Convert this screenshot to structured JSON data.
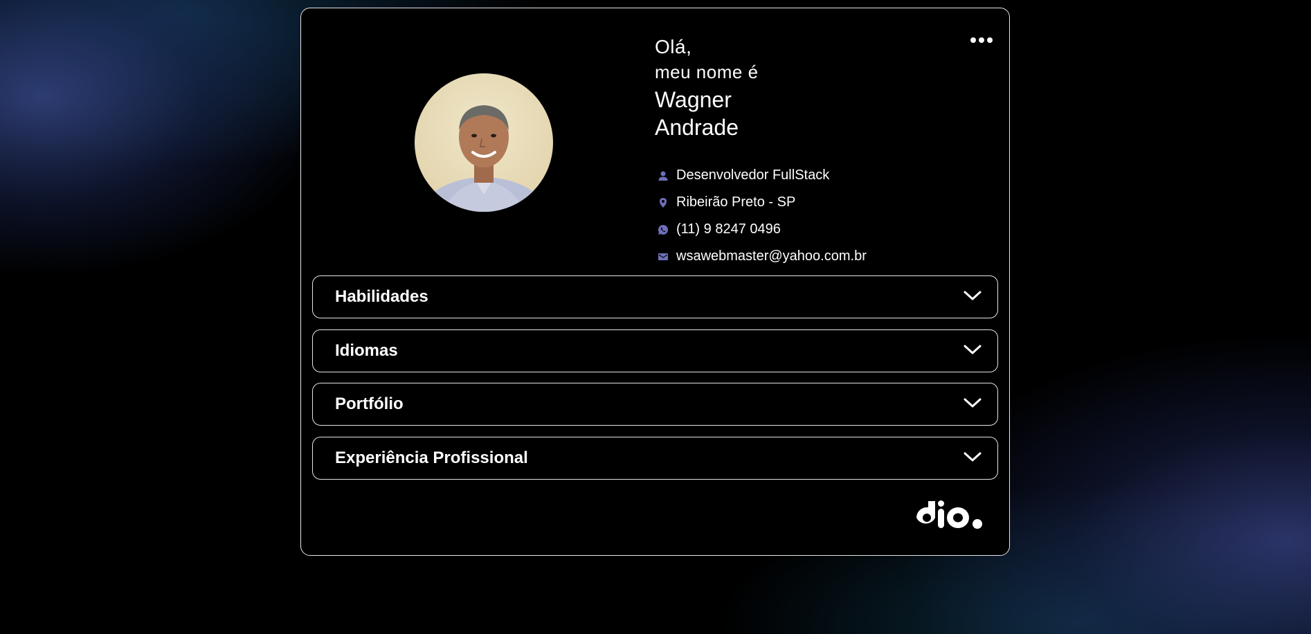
{
  "header": {
    "greeting": "Olá,",
    "subgreeting": "meu nome é",
    "first_name": "Wagner",
    "last_name": "Andrade"
  },
  "info": {
    "role": "Desenvolvedor FullStack",
    "location": "Ribeirão Preto - SP",
    "phone": "(11) 9 8247 0496",
    "email": "wsawebmaster@yahoo.com.br"
  },
  "accordions": [
    {
      "label": "Habilidades"
    },
    {
      "label": "Idiomas"
    },
    {
      "label": "Portfólio"
    },
    {
      "label": "Experiência Profissional"
    }
  ],
  "logo": "dio.",
  "colors": {
    "icon_accent": "#6e6fb8",
    "card_border": "#e6e6e6",
    "background": "#000000"
  },
  "icons": {
    "menu": "more-dots-icon",
    "role": "person-icon",
    "location": "location-pin-icon",
    "phone": "whatsapp-icon",
    "email": "mail-icon",
    "accordion": "chevron-down-icon"
  }
}
